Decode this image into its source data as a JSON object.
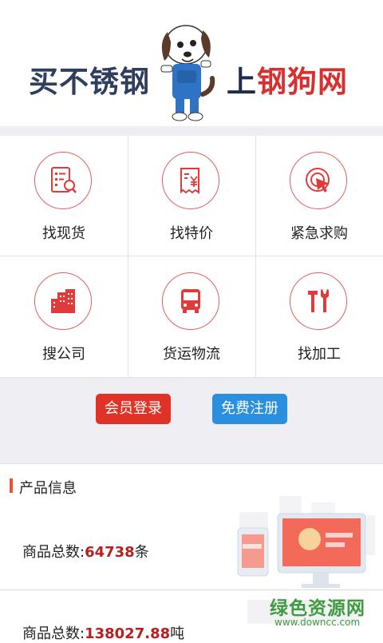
{
  "banner": {
    "slogan_left": "买不锈钢",
    "slogan_right_prefix": "上",
    "slogan_right_brand": "钢狗网"
  },
  "menu": {
    "items": [
      {
        "label": "找现货",
        "icon": "document-search-icon"
      },
      {
        "label": "找特价",
        "icon": "price-tag-icon"
      },
      {
        "label": "紧急求购",
        "icon": "target-cursor-icon"
      },
      {
        "label": "搜公司",
        "icon": "buildings-icon"
      },
      {
        "label": "货运物流",
        "icon": "bus-icon"
      },
      {
        "label": "找加工",
        "icon": "tools-icon"
      }
    ]
  },
  "auth": {
    "login_label": "会员登录",
    "register_label": "免费注册"
  },
  "product": {
    "section_title": "产品信息",
    "stats": [
      {
        "prefix": "商品总数:",
        "value": "64738",
        "unit": "条"
      },
      {
        "prefix": "商品总数:",
        "value": "138027.88",
        "unit": "吨"
      }
    ]
  },
  "watermark": {
    "line1": "绿色资源网",
    "line2": "www.downcc.com"
  },
  "colors": {
    "accent_red": "#e03226",
    "accent_blue": "#2b8fe0",
    "icon_red": "#e03a3a",
    "number_red": "#b91f1f"
  }
}
